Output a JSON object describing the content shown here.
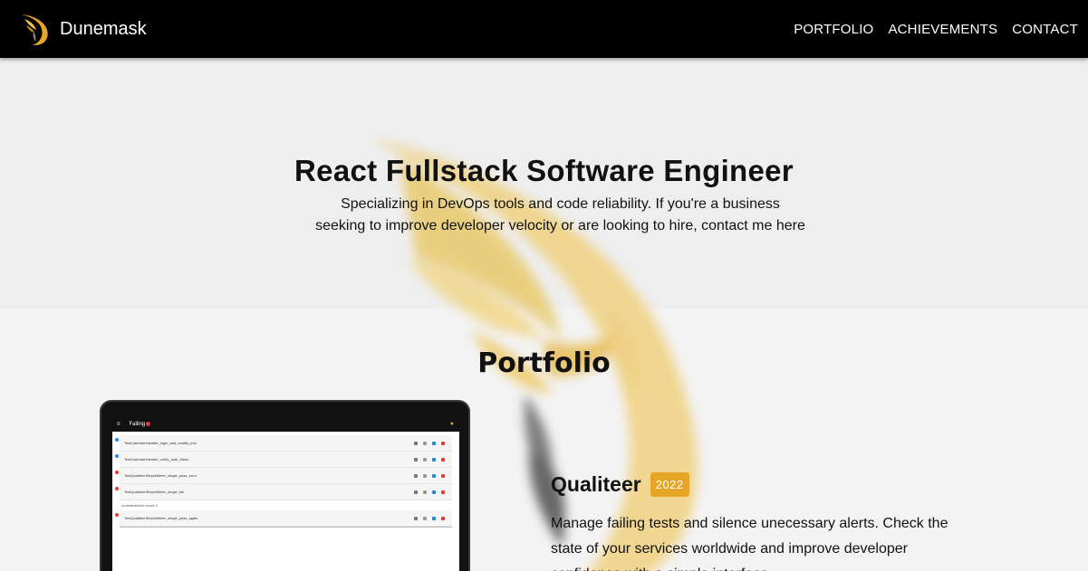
{
  "nav": {
    "brand": "Dunemask",
    "links": [
      "PORTFOLIO",
      "ACHIEVEMENTS",
      "CONTACT"
    ]
  },
  "hero": {
    "title": "React Fullstack Software Engineer",
    "subtitle": "Specializing in DevOps tools and code reliability. If you're a business seeking to improve developer velocity or are looking to hire, contact me here"
  },
  "portfolio": {
    "title": "Portfolio",
    "project": {
      "name": "Qualiteer",
      "year": "2022",
      "description": "Manage failing tests and silence unecessary alerts. Check the state of your services worldwide and improve developer confidence with a simple interface."
    },
    "screenshot": {
      "app_title": "Failing",
      "tests": [
        {
          "name": "TestCalendarHandler_login_and_modify_info",
          "status": "info"
        },
        {
          "name": "TestCalendarHandler_verify_auth_token",
          "status": "info"
        },
        {
          "name": "TestQualiteerSimpleMeter_single_pass_error",
          "status": "fail"
        },
        {
          "name": "TestQualiteerSimpleMeter_single_fail",
          "status": "fail"
        },
        {
          "name": "TestQualiteerSimpleMeter_single_pass_again",
          "status": "fail"
        }
      ],
      "note": "nonefaulted/nt count 3"
    }
  },
  "colors": {
    "accent": "#e7a525",
    "navbar": "#000000",
    "info_dot": "#1e88e5",
    "fail_dot": "#e53935"
  },
  "icons": {
    "brand": "phoenix-d-logo",
    "menu": "hamburger-icon"
  }
}
